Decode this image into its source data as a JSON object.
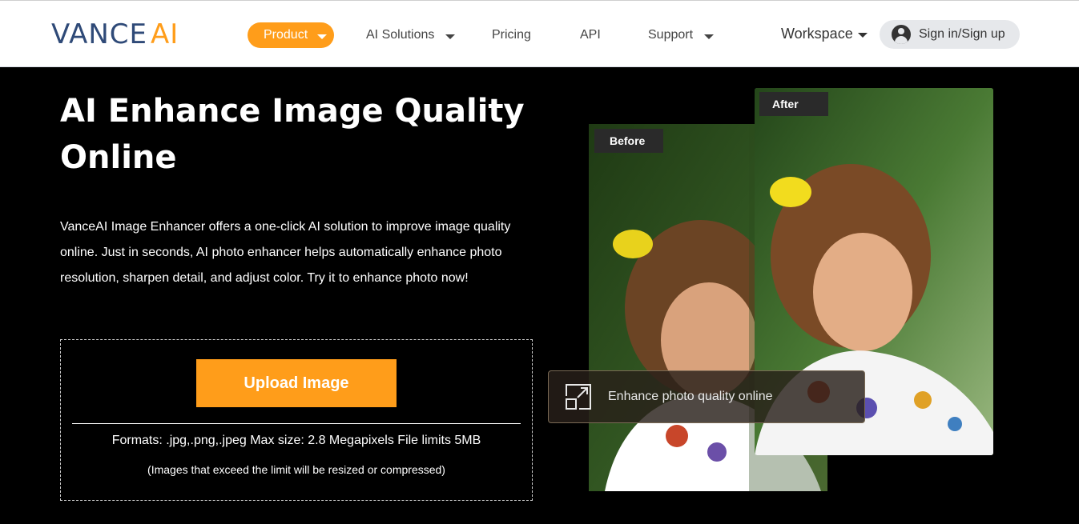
{
  "header": {
    "logo": {
      "vance": "VANCE",
      "ai": "AI"
    },
    "nav": {
      "product": "Product",
      "ai_solutions": "AI Solutions",
      "pricing": "Pricing",
      "api": "API",
      "support": "Support",
      "workspace": "Workspace"
    },
    "signin_label": "Sign in/Sign up"
  },
  "hero": {
    "title": "AI Enhance Image Quality Online",
    "description": "VanceAI Image Enhancer offers a one-click AI solution to improve image quality online. Just in seconds, AI photo enhancer helps automatically enhance photo resolution, sharpen detail, and adjust color. Try it to enhance photo now!"
  },
  "upload": {
    "button_label": "Upload Image",
    "formats": "Formats: .jpg,.png,.jpeg Max size: 2.8 Megapixels File limits 5MB",
    "note": "(Images that exceed the limit will be resized or compressed)"
  },
  "preview": {
    "before_label": "Before",
    "after_label": "After",
    "enhance_label": "Enhance photo quality online"
  },
  "colors": {
    "accent": "#ff9d1a",
    "logo_blue": "#2f4a78",
    "background": "#000000"
  },
  "icons": {
    "caret": "chevron-down-icon",
    "user": "user-icon",
    "expand": "expand-icon"
  }
}
